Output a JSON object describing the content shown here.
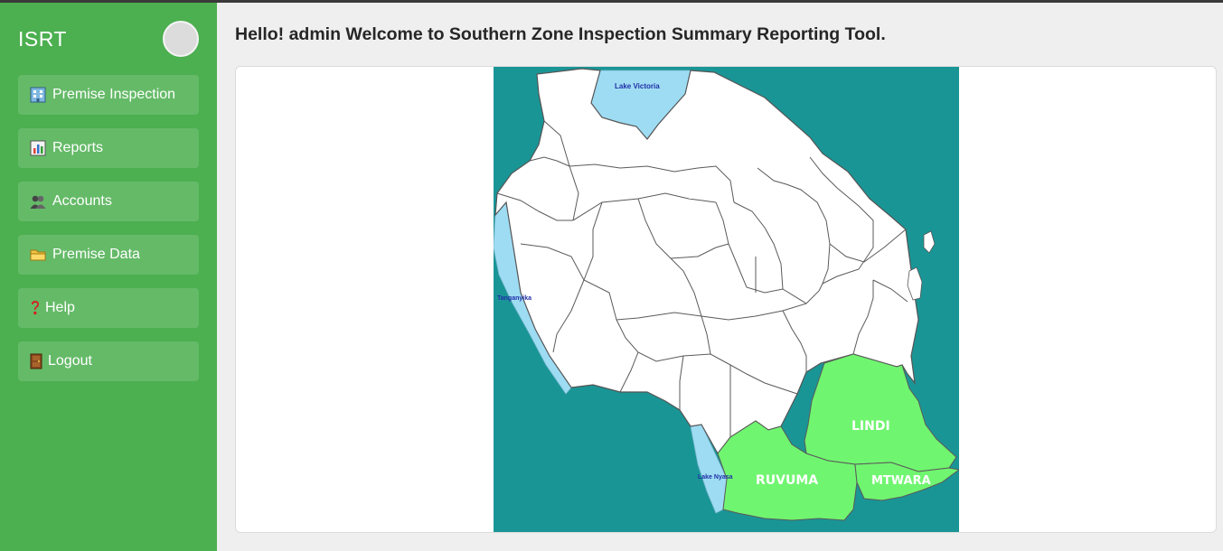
{
  "app": {
    "brand": "ISRT"
  },
  "sidebar": {
    "items": [
      {
        "label": "Premise Inspection",
        "icon": "building-icon"
      },
      {
        "label": "Reports",
        "icon": "bar-chart-icon"
      },
      {
        "label": "Accounts",
        "icon": "users-icon"
      },
      {
        "label": "Premise Data",
        "icon": "folder-icon"
      },
      {
        "label": "Help",
        "icon": "question-icon"
      },
      {
        "label": "Logout",
        "icon": "door-icon"
      }
    ]
  },
  "header": {
    "greeting": "Hello! admin Welcome to Southern Zone Inspection Summary Reporting Tool."
  },
  "map": {
    "lakes": {
      "victoria": "Lake Victoria",
      "tanganyika": "Tanganyika",
      "nyasa": "Lake Nyasa"
    },
    "regions": {
      "lindi": "LINDI",
      "ruvuma": "RUVUMA",
      "mtwara": "MTWARA"
    },
    "colors": {
      "sea": "#1a9596",
      "lake": "#9edcf3",
      "highlight": "#70f570",
      "land": "#ffffff"
    }
  }
}
